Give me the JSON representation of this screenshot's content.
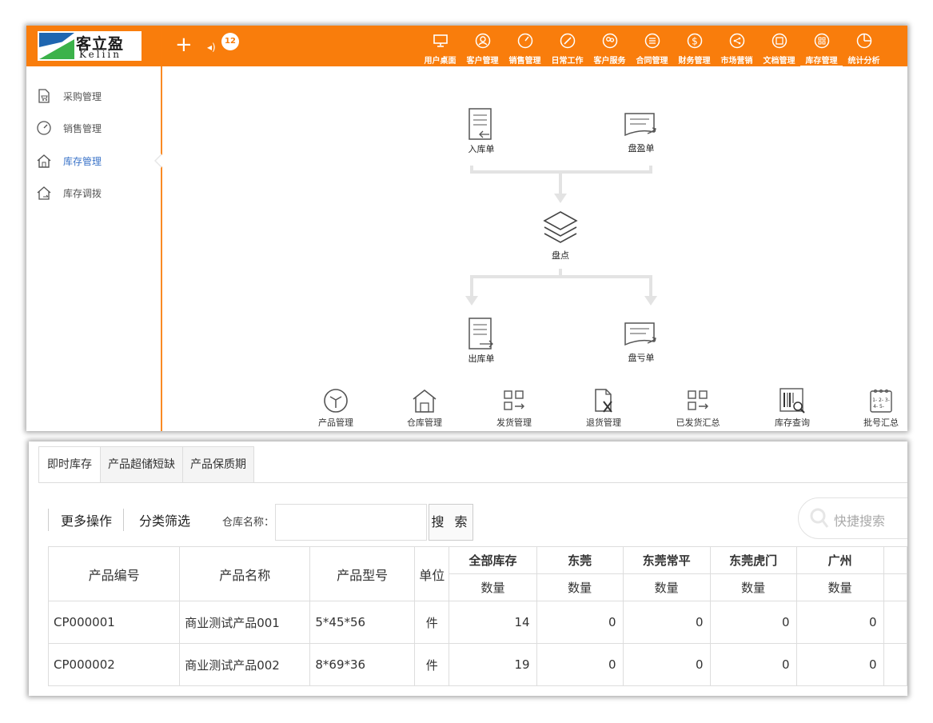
{
  "logo": {
    "cn": "客立盈",
    "en": "Keliin"
  },
  "header": {
    "notif_count": "12",
    "nav": [
      {
        "label": "用户桌面",
        "icon": "monitor-icon"
      },
      {
        "label": "客户管理",
        "icon": "user-circle-icon"
      },
      {
        "label": "销售管理",
        "icon": "gauge-icon"
      },
      {
        "label": "日常工作",
        "icon": "pencil-icon"
      },
      {
        "label": "客户服务",
        "icon": "people-icon"
      },
      {
        "label": "合同管理",
        "icon": "list-icon"
      },
      {
        "label": "财务管理",
        "icon": "dollar-icon"
      },
      {
        "label": "市场营销",
        "icon": "share-icon"
      },
      {
        "label": "文档管理",
        "icon": "folder-icon"
      },
      {
        "label": "库存管理",
        "icon": "grid-icon"
      },
      {
        "label": "统计分析",
        "icon": "pie-icon"
      }
    ]
  },
  "sidebar": {
    "items": [
      {
        "label": "采购管理",
        "icon": "cart-doc-icon"
      },
      {
        "label": "销售管理",
        "icon": "gauge-icon"
      },
      {
        "label": "库存管理",
        "icon": "home-icon"
      },
      {
        "label": "库存调拨",
        "icon": "transfer-home-icon"
      }
    ]
  },
  "flow": {
    "in": "入库单",
    "surplus": "盘盈单",
    "check": "盘点",
    "out": "出库单",
    "loss": "盘亏单"
  },
  "bottom_icons": [
    {
      "label": "产品管理",
      "icon": "box-icon"
    },
    {
      "label": "仓库管理",
      "icon": "warehouse-icon"
    },
    {
      "label": "发货管理",
      "icon": "ship-icon"
    },
    {
      "label": "退货管理",
      "icon": "return-icon"
    },
    {
      "label": "已发货汇总",
      "icon": "shipped-summary-icon"
    },
    {
      "label": "库存查询",
      "icon": "barcode-search-icon"
    },
    {
      "label": "批号汇总",
      "icon": "calendar-icon"
    }
  ],
  "tabs": [
    "即时库存",
    "产品超储短缺",
    "产品保质期"
  ],
  "toolbar": {
    "more": "更多操作",
    "filter": "分类筛选",
    "warehouse_label": "仓库名称：",
    "warehouse_value": "",
    "search": "搜 索",
    "quick_search_placeholder": "快捷搜索"
  },
  "table": {
    "columns": [
      "产品编号",
      "产品名称",
      "产品型号",
      "单位"
    ],
    "groups": [
      "全部库存",
      "东莞",
      "东莞常平",
      "东莞虎门",
      "广州"
    ],
    "sub": "数量",
    "rows": [
      {
        "code": "CP000001",
        "name": "商业测试产品001",
        "model": "5*45*56",
        "unit": "件",
        "qty": [
          "14",
          "0",
          "0",
          "0",
          "0"
        ]
      },
      {
        "code": "CP000002",
        "name": "商业测试产品002",
        "model": "8*69*36",
        "unit": "件",
        "qty": [
          "19",
          "0",
          "0",
          "0",
          "0"
        ]
      }
    ]
  }
}
